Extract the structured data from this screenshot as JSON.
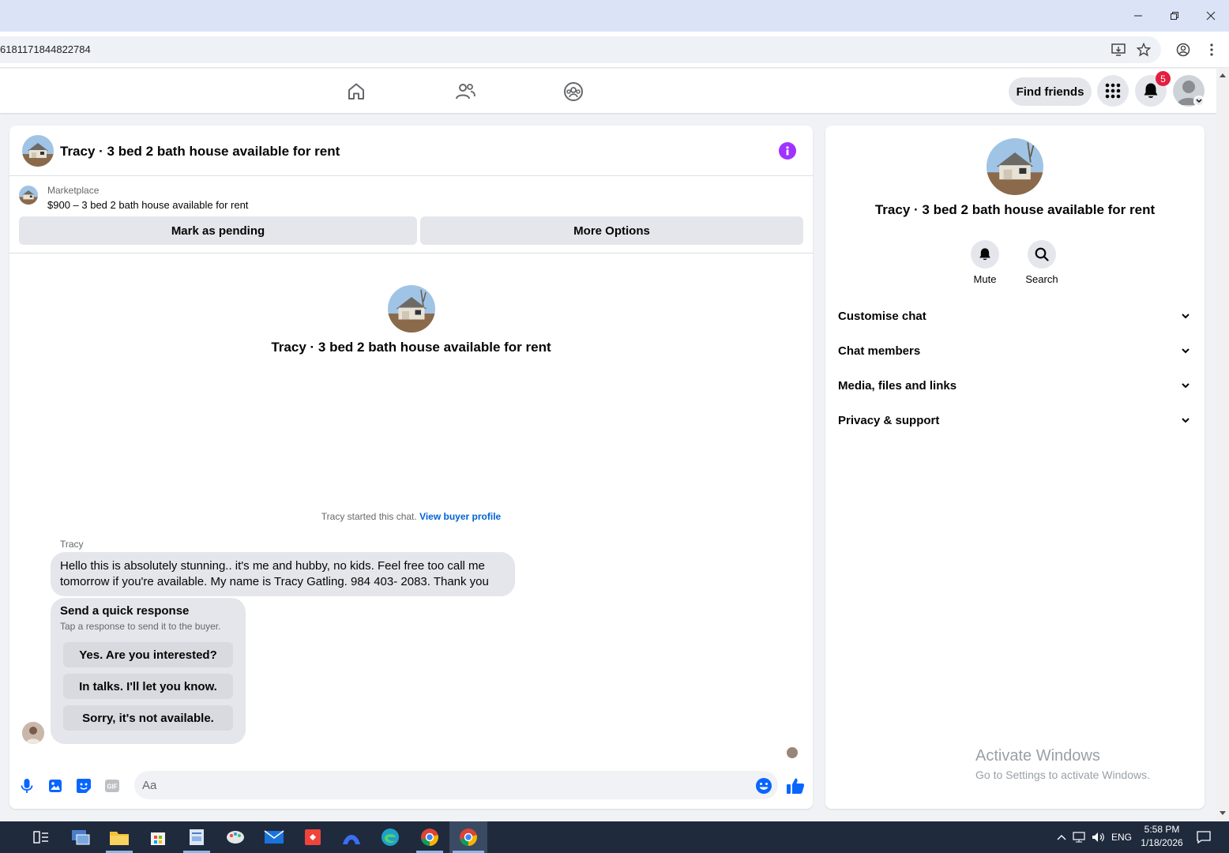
{
  "browser": {
    "url": "6181171844822784"
  },
  "nav": {
    "find_friends_label": "Find friends",
    "notification_count": "5"
  },
  "chat": {
    "title": "Tracy · 3 bed 2 bath house available for rent",
    "marketplace_label": "Marketplace",
    "listing_line": "$900 – 3 bed 2 bath house available for rent",
    "mark_pending_label": "Mark as pending",
    "more_options_label": "More Options",
    "center_title": "Tracy · 3 bed 2 bath house available for rent",
    "started_text": "Tracy started this chat.",
    "view_buyer_profile_label": "View buyer profile",
    "sender_name": "Tracy",
    "message_line1": "Hello this is absolutely stunning.. it's me and hubby, no kids. Feel free too call me",
    "message_line2": "tomorrow if you're available.  My name is Tracy Gatling.  984 403- 2083. Thank you",
    "quick_response": {
      "title": "Send a quick response",
      "subtitle": "Tap a response to send it to the buyer.",
      "options": [
        "Yes. Are you interested?",
        "In talks. I'll let you know.",
        "Sorry, it's not available."
      ]
    },
    "composer_placeholder": "Aa"
  },
  "info_panel": {
    "title": "Tracy · 3 bed 2 bath house available for rent",
    "mute_label": "Mute",
    "search_label": "Search",
    "sections": [
      "Customise chat",
      "Chat members",
      "Media, files and links",
      "Privacy & support"
    ]
  },
  "watermark": {
    "line1": "Activate Windows",
    "line2": "Go to Settings to activate Windows."
  },
  "taskbar": {
    "lang": "ENG",
    "time": "5:58 PM",
    "date": "1/18/2026"
  },
  "colors": {
    "fb_blue": "#0866ff",
    "info_purple": "#a033ff",
    "badge_red": "#e41e3f",
    "taskbar": "#1f2a3d"
  }
}
